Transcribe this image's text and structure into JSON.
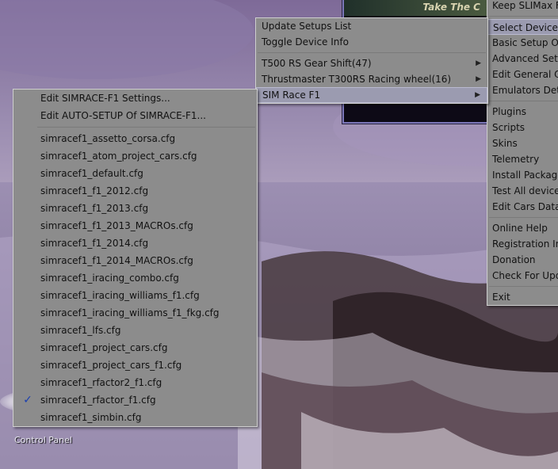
{
  "desktop": {
    "icon_label": "Control Panel",
    "window_banner": "Take The C"
  },
  "main_menu": {
    "items": [
      {
        "label": "Keep SLIMax F",
        "type": "item"
      },
      {
        "type": "separator"
      },
      {
        "label": "Select Device",
        "type": "item",
        "highlighted": true
      },
      {
        "label": "Basic Setup Op",
        "type": "item"
      },
      {
        "label": "Advanced Setu",
        "type": "item"
      },
      {
        "label": "Edit General O",
        "type": "item"
      },
      {
        "label": "Emulators Det",
        "type": "item"
      },
      {
        "type": "separator"
      },
      {
        "label": "Plugins",
        "type": "item"
      },
      {
        "label": "Scripts",
        "type": "item"
      },
      {
        "label": "Skins",
        "type": "item"
      },
      {
        "label": "Telemetry",
        "type": "item"
      },
      {
        "label": "Install Package",
        "type": "item"
      },
      {
        "label": "Test All device",
        "type": "item"
      },
      {
        "label": "Edit Cars Data",
        "type": "item"
      },
      {
        "type": "separator"
      },
      {
        "label": "Online Help",
        "type": "item"
      },
      {
        "label": "Registration In",
        "type": "item"
      },
      {
        "label": "Donation",
        "type": "item"
      },
      {
        "label": "Check For Upd",
        "type": "item"
      },
      {
        "type": "separator"
      },
      {
        "label": "Exit",
        "type": "item"
      }
    ]
  },
  "device_menu": {
    "items": [
      {
        "label": "Update Setups List",
        "type": "item"
      },
      {
        "label": "Toggle Device Info",
        "type": "item"
      },
      {
        "type": "separator"
      },
      {
        "label": "T500 RS Gear Shift(47)",
        "type": "item",
        "submenu": true
      },
      {
        "label": "Thrustmaster T300RS Racing wheel(16)",
        "type": "item",
        "submenu": true
      },
      {
        "label": "SIM Race F1",
        "type": "item",
        "submenu": true,
        "highlighted": true
      }
    ],
    "arrow_glyph": "▶"
  },
  "setups_menu": {
    "check_glyph": "✓",
    "items": [
      {
        "label": "Edit SIMRACE-F1 Settings...",
        "type": "item"
      },
      {
        "label": "Edit AUTO-SETUP Of SIMRACE-F1...",
        "type": "item"
      },
      {
        "type": "separator"
      },
      {
        "label": "simracef1_assetto_corsa.cfg",
        "type": "item"
      },
      {
        "label": "simracef1_atom_project_cars.cfg",
        "type": "item"
      },
      {
        "label": "simracef1_default.cfg",
        "type": "item"
      },
      {
        "label": "simracef1_f1_2012.cfg",
        "type": "item"
      },
      {
        "label": "simracef1_f1_2013.cfg",
        "type": "item"
      },
      {
        "label": "simracef1_f1_2013_MACROs.cfg",
        "type": "item"
      },
      {
        "label": "simracef1_f1_2014.cfg",
        "type": "item"
      },
      {
        "label": "simracef1_f1_2014_MACROs.cfg",
        "type": "item"
      },
      {
        "label": "simracef1_iracing_combo.cfg",
        "type": "item"
      },
      {
        "label": "simracef1_iracing_williams_f1.cfg",
        "type": "item"
      },
      {
        "label": "simracef1_iracing_williams_f1_fkg.cfg",
        "type": "item"
      },
      {
        "label": "simracef1_lfs.cfg",
        "type": "item"
      },
      {
        "label": "simracef1_project_cars.cfg",
        "type": "item"
      },
      {
        "label": "simracef1_project_cars_f1.cfg",
        "type": "item"
      },
      {
        "label": "simracef1_rfactor2_f1.cfg",
        "type": "item"
      },
      {
        "label": "simracef1_rfactor_f1.cfg",
        "type": "item",
        "checked": true
      },
      {
        "label": "simracef1_simbin.cfg",
        "type": "item"
      }
    ]
  },
  "colors": {
    "menu_bg": "#8c8c8c",
    "highlight": "#9b9bb0",
    "check": "#1a3fb0"
  }
}
